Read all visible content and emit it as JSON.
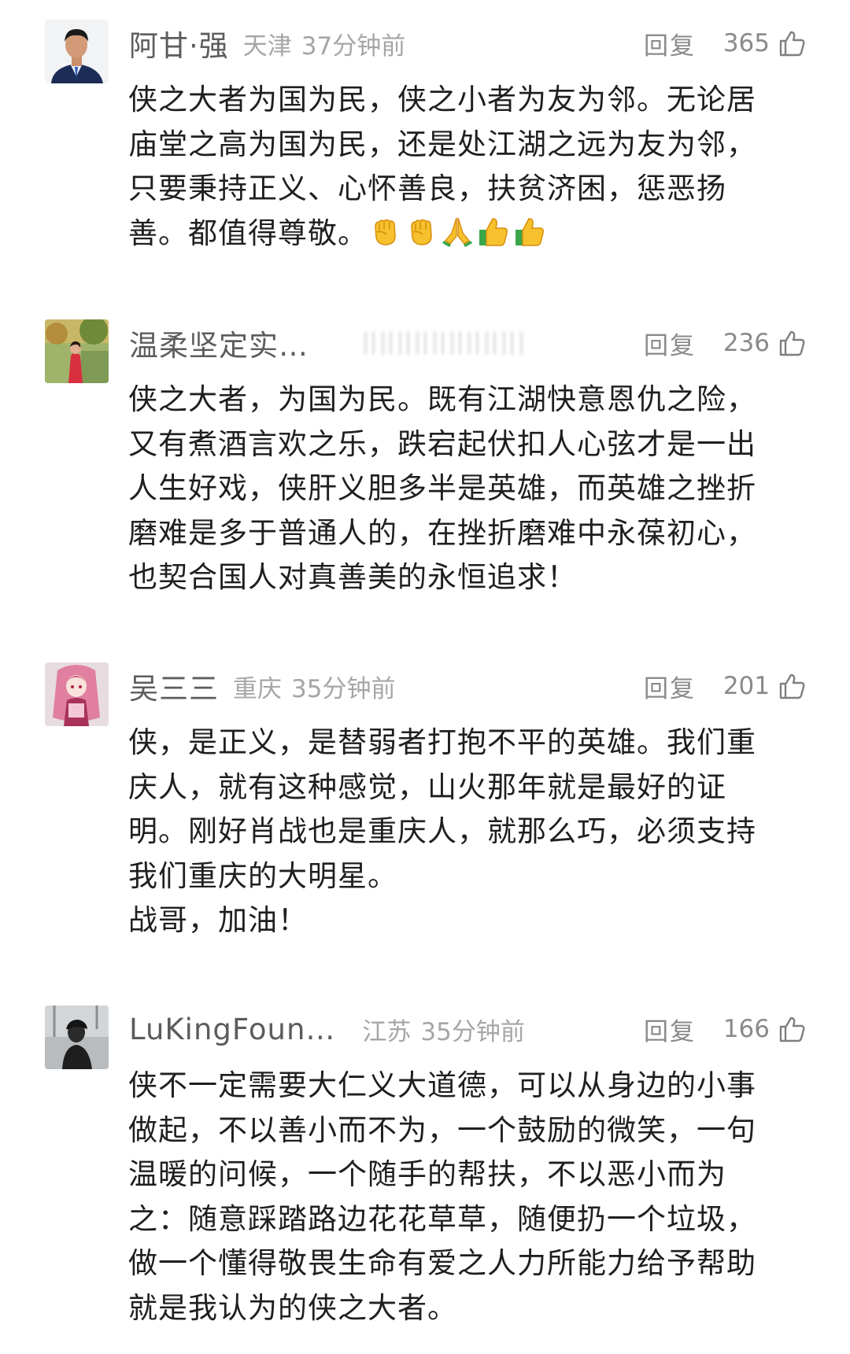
{
  "comments": [
    {
      "username": "阿甘·强",
      "location": "天津",
      "time": "37分钟前",
      "reply_label": "回复",
      "likes": "365",
      "content": "侠之大者为国为民，侠之小者为友为邻。无论居\n庙堂之高为国为民，还是处江湖之远为友为邻，\n只要秉持正义、心怀善良，扶贫济困，惩恶扬\n善。都值得尊敬。",
      "emojis": [
        "fist-icon",
        "fist-icon",
        "pray-icon",
        "thumbs-up-icon",
        "thumbs-up-icon"
      ]
    },
    {
      "username": "温柔坚定实…",
      "reply_label": "回复",
      "likes": "236",
      "content": "侠之大者，为国为民。既有江湖快意恩仇之险，\n又有煮酒言欢之乐，跌宕起伏扣人心弦才是一出\n人生好戏，侠肝义胆多半是英雄，而英雄之挫折\n磨难是多于普通人的，在挫折磨难中永葆初心，\n也契合国人对真善美的永恒追求！"
    },
    {
      "username": "吴三三",
      "location": "重庆",
      "time": "35分钟前",
      "reply_label": "回复",
      "likes": "201",
      "content": "侠，是正义，是替弱者打抱不平的英雄。我们重\n庆人，就有这种感觉，山火那年就是最好的证\n明。刚好肖战也是重庆人，就那么巧，必须支持\n我们重庆的大明星。\n战哥，加油！"
    },
    {
      "username": "LuKingFoun…",
      "location": "江苏",
      "time": "35分钟前",
      "reply_label": "回复",
      "likes": "166",
      "content": "侠不一定需要大仁义大道德，可以从身边的小事\n做起，不以善小而不为，一个鼓励的微笑，一句\n温暖的问候，一个随手的帮扶，不以恶小而为\n之：随意踩踏路边花花草草，随便扔一个垃圾，\n做一个懂得敬畏生命有爱之人力所能力给予帮助\n就是我认为的侠之大者。"
    }
  ]
}
